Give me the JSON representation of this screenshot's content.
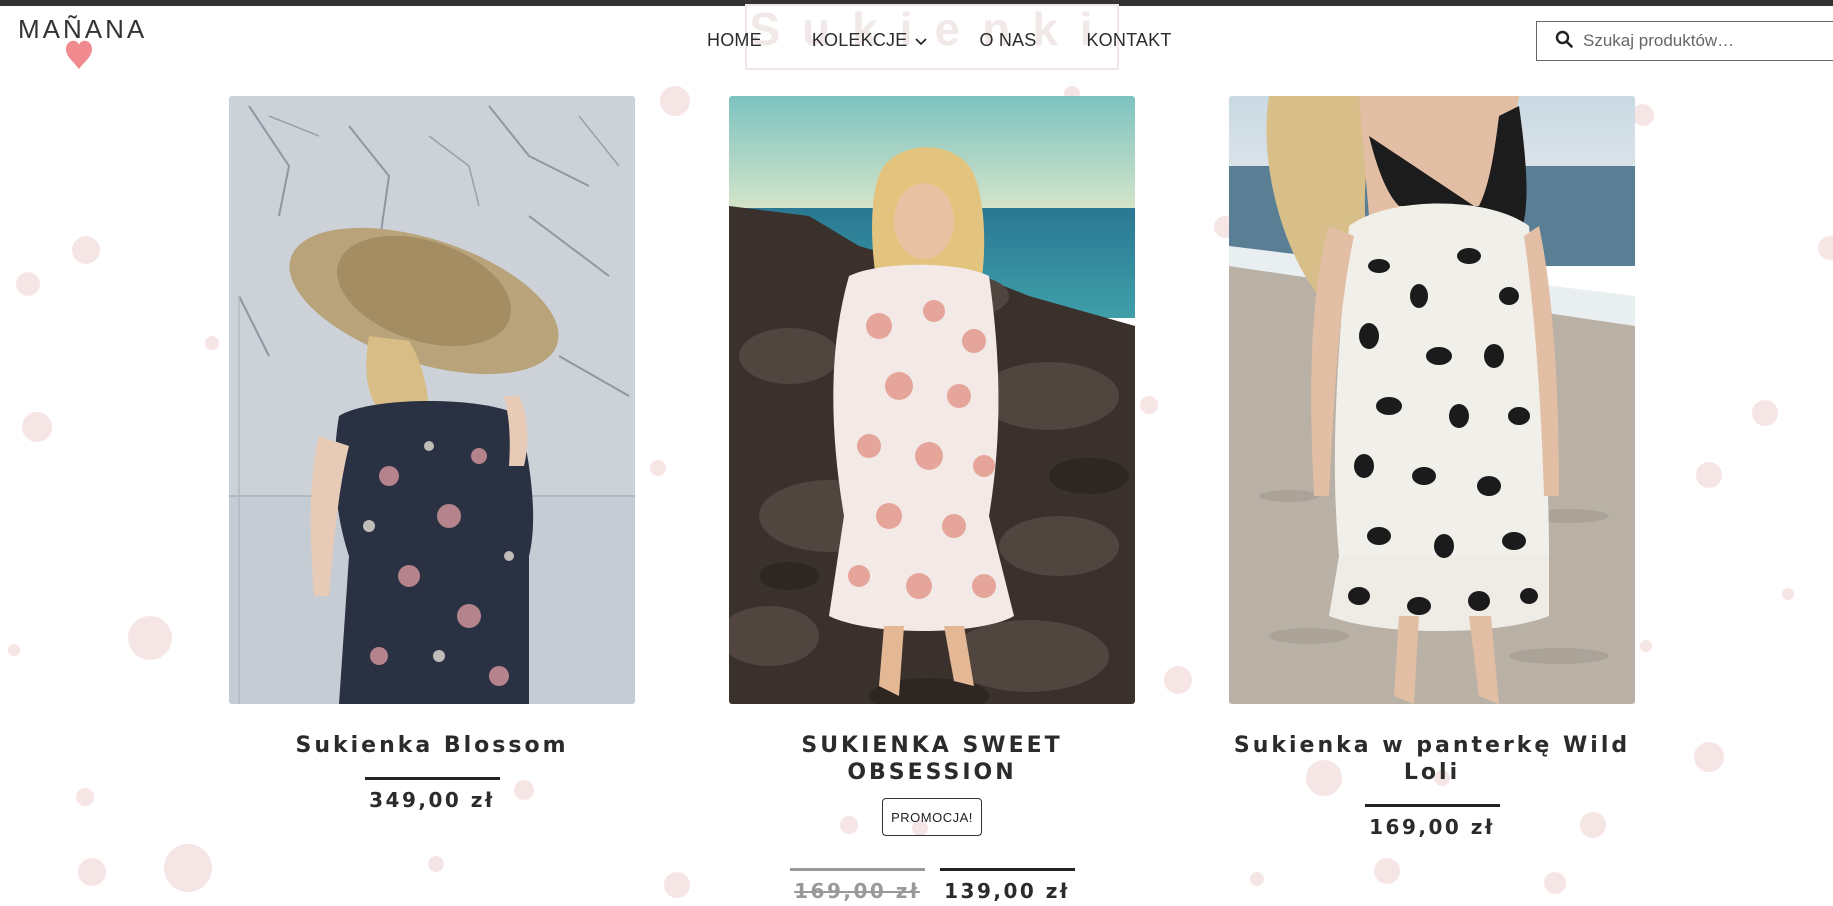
{
  "brand": {
    "logo_text": "MAÑANA"
  },
  "background_heading": "Sukienki",
  "nav": {
    "items": [
      {
        "label": "HOME"
      },
      {
        "label": "KOLEKCJE"
      },
      {
        "label": "O NAS"
      },
      {
        "label": "KONTAKT"
      }
    ]
  },
  "search": {
    "placeholder": "Szukaj produktów…"
  },
  "products": [
    {
      "title": "Sukienka Blossom",
      "price": "349,00 zł",
      "image": "Woman in a large straw hat wearing a navy floral wrap dress against a cracked marble wall"
    },
    {
      "title": "SUKIENKA SWEET OBSESSION",
      "badge": "PROMOCJA!",
      "old_price": "169,00 zł",
      "price": "139,00 zł",
      "image": "Blonde woman in a white dress with coral polka dots standing on dark rocks by the sea"
    },
    {
      "title": "Sukienka w panterkę Wild Loli",
      "price": "169,00 zł",
      "image": "Woman in a black and white leopard print slip dress on a sandy beach"
    }
  ],
  "colors": {
    "accent_dots": "#f3dcdc",
    "text": "#2b2b2b",
    "heart": "#f08a8f"
  }
}
